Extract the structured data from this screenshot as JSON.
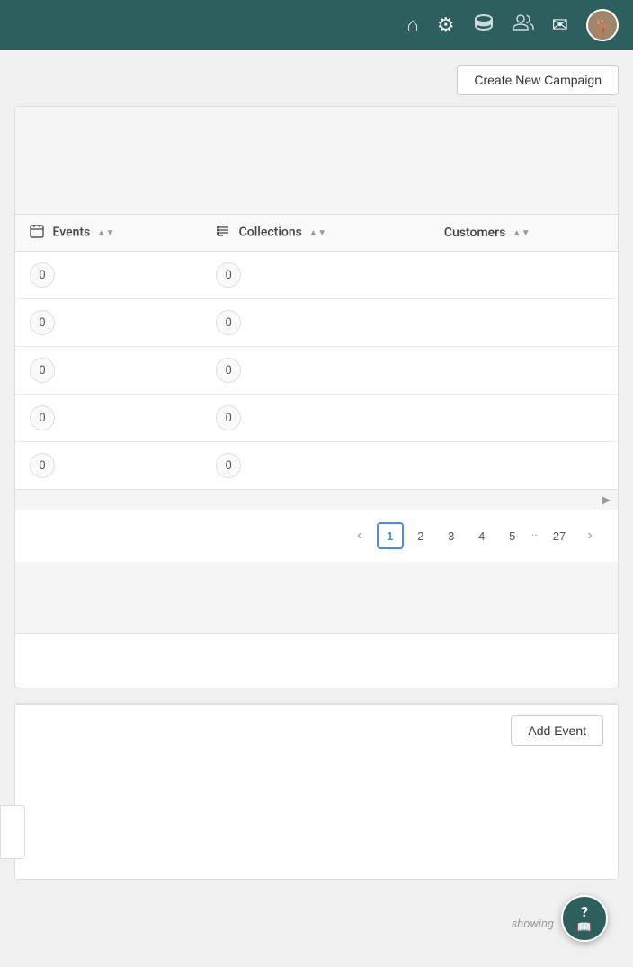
{
  "nav": {
    "icons": [
      "home",
      "gear",
      "theater",
      "users",
      "mail"
    ],
    "avatar_label": "👤"
  },
  "toolbar": {
    "create_campaign_label": "Create New Campaign"
  },
  "table": {
    "columns": [
      {
        "id": "events",
        "label": "Events",
        "has_icon": true,
        "icon": "calendar"
      },
      {
        "id": "collections",
        "label": "Collections",
        "has_icon": true,
        "icon": "list"
      },
      {
        "id": "customers",
        "label": "Customers",
        "has_icon": false
      }
    ],
    "rows": [
      {
        "events": "0",
        "collections": "0",
        "customers": ""
      },
      {
        "events": "0",
        "collections": "0",
        "customers": ""
      },
      {
        "events": "0",
        "collections": "0",
        "customers": ""
      },
      {
        "events": "0",
        "collections": "0",
        "customers": ""
      },
      {
        "events": "0",
        "collections": "0",
        "customers": ""
      }
    ]
  },
  "pagination": {
    "prev_label": "‹",
    "next_label": "›",
    "pages": [
      "1",
      "2",
      "3",
      "4",
      "5"
    ],
    "dots": "···",
    "last_page": "27",
    "current_page": "1"
  },
  "add_event": {
    "button_label": "Add Event"
  },
  "footer": {
    "showing_label": "showing"
  },
  "help": {
    "icon_label": "?"
  }
}
